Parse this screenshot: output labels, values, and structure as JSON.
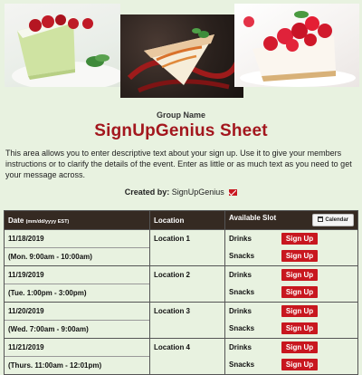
{
  "header": {
    "group_name": "Group Name",
    "title": "SignUpGenius Sheet",
    "description": "This area allows you to enter descriptive text about your sign up. Use it to give your members instructions or to clarify the details of the event. Enter as little or as much text as you need to get your message across.",
    "created_by_label": "Created by:",
    "created_by_name": "SignUpGenius"
  },
  "table": {
    "col_date": "Date",
    "col_date_hint": "(mm/dd/yyyy EST)",
    "col_location": "Location",
    "col_slot": "Available Slot",
    "calendar_label": "Calendar",
    "button_label": "Sign Up",
    "rows": [
      {
        "date": "11/18/2019",
        "time": "(Mon. 9:00am - 10:00am)",
        "location": "Location 1",
        "slots": [
          "Drinks",
          "Snacks"
        ]
      },
      {
        "date": "11/19/2019",
        "time": "(Tue. 1:00pm - 3:00pm)",
        "location": "Location 2",
        "slots": [
          "Drinks",
          "Snacks"
        ]
      },
      {
        "date": "11/20/2019",
        "time": "(Wed. 7:00am - 9:00am)",
        "location": "Location 3",
        "slots": [
          "Drinks",
          "Snacks"
        ]
      },
      {
        "date": "11/21/2019",
        "time": "(Thurs. 11:00am - 12:01pm)",
        "location": "Location 4",
        "slots": [
          "Drinks",
          "Snacks"
        ]
      }
    ]
  },
  "colors": {
    "accent": "#a3171e",
    "button": "#c8171f",
    "header_bg": "#352a22",
    "page_bg": "#e8f2e0"
  }
}
